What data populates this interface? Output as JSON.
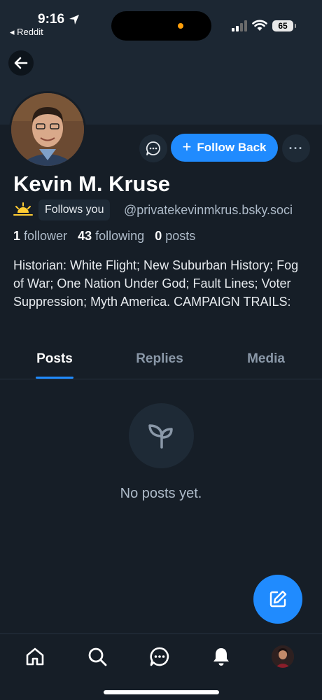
{
  "status_bar": {
    "time": "9:16",
    "back_app": "◂ Reddit",
    "battery": "65"
  },
  "profile": {
    "display_name": "Kevin M. Kruse",
    "follows_you_badge": "Follows you",
    "handle": "@privatekevinmkrus.bsky.soci",
    "stats": {
      "followers_count": "1",
      "followers_label": "follower",
      "following_count": "43",
      "following_label": "following",
      "posts_count": "0",
      "posts_label": "posts"
    },
    "bio": "Historian: White Flight; New Suburban History; Fog of War; One Nation Under God; Fault Lines; Voter Suppression; Myth America. CAMPAIGN TRAILS:"
  },
  "actions": {
    "follow_back_label": "Follow Back",
    "more_label": "···"
  },
  "tabs": [
    {
      "label": "Posts",
      "active": true
    },
    {
      "label": "Replies",
      "active": false
    },
    {
      "label": "Media",
      "active": false
    }
  ],
  "empty_state": {
    "text": "No posts yet.",
    "icon": "sprout-icon"
  },
  "bottom_nav": [
    {
      "icon": "home-icon"
    },
    {
      "icon": "search-icon"
    },
    {
      "icon": "chat-icon"
    },
    {
      "icon": "bell-icon"
    },
    {
      "icon": "profile-avatar"
    }
  ],
  "colors": {
    "background": "#161e27",
    "banner": "#1c2733",
    "accent": "#208bfe",
    "muted_text": "#aebbc9"
  }
}
